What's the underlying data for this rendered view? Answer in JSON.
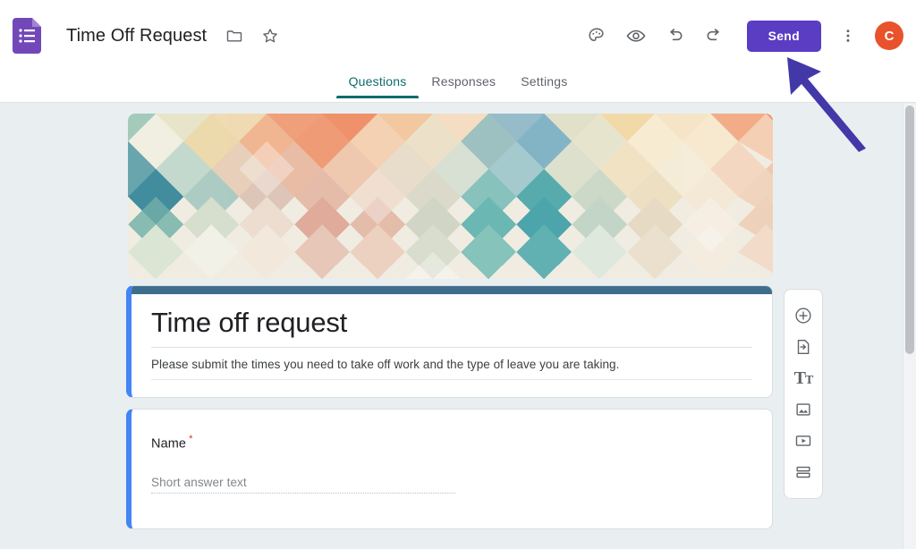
{
  "header": {
    "app_icon": "google-forms-icon",
    "doc_title": "Time Off Request",
    "move_icon": "folder-icon",
    "star_icon": "star-icon",
    "theme_icon": "palette-icon",
    "preview_icon": "eye-icon",
    "undo_icon": "undo-icon",
    "redo_icon": "redo-icon",
    "send_label": "Send",
    "more_icon": "more-vertical-icon",
    "avatar_initial": "C"
  },
  "tabs": [
    {
      "label": "Questions",
      "active": true
    },
    {
      "label": "Responses",
      "active": false
    },
    {
      "label": "Settings",
      "active": false
    }
  ],
  "banner": {
    "alt": "geometric-diamond-pattern-header"
  },
  "form": {
    "title": "Time off request",
    "description": "Please submit the times you need to take off work and the type of leave you are taking."
  },
  "questions": [
    {
      "label": "Name",
      "required_marker": "*",
      "answer_placeholder": "Short answer text",
      "type": "short-answer"
    }
  ],
  "side_toolbar": [
    {
      "icon": "add-question-icon",
      "name": "add-question"
    },
    {
      "icon": "import-questions-icon",
      "name": "import-questions"
    },
    {
      "icon": "add-title-description-icon",
      "name": "add-title-and-description"
    },
    {
      "icon": "add-image-icon",
      "name": "add-image"
    },
    {
      "icon": "add-video-icon",
      "name": "add-video"
    },
    {
      "icon": "add-section-icon",
      "name": "add-section"
    }
  ],
  "annotation": {
    "arrow_color": "#4338a8",
    "points_to": "send-button"
  },
  "colors": {
    "send_button": "#5b3dc4",
    "avatar": "#e8522c",
    "card_accent": "#4285f4",
    "title_bar": "#3f6e8c",
    "active_tab": "#0f6b6b",
    "page_background": "#e9eff1",
    "required_asterisk": "#d93025"
  }
}
